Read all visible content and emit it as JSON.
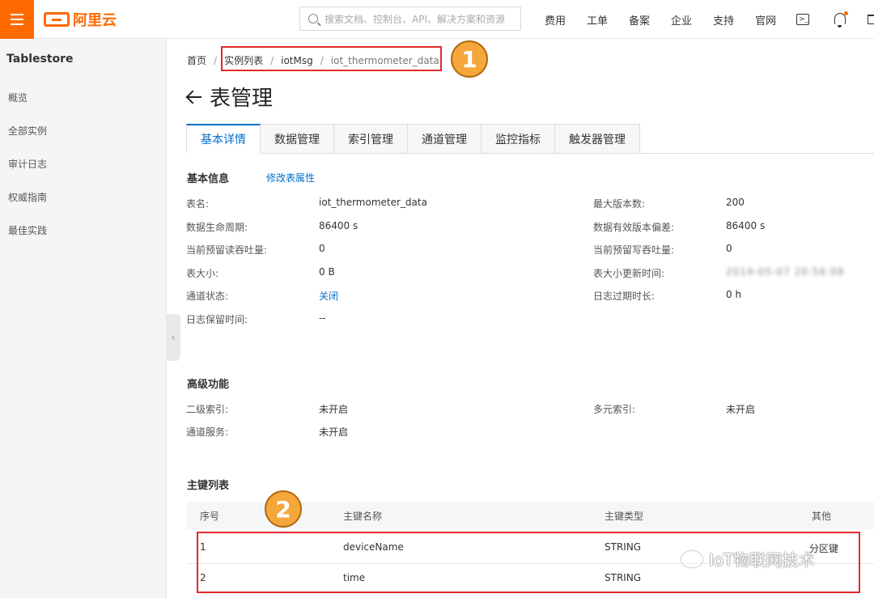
{
  "topbar": {
    "logo_text": "阿里云",
    "search_placeholder": "搜索文档、控制台、API、解决方案和资源",
    "nav": [
      "费用",
      "工单",
      "备案",
      "企业",
      "支持",
      "官网"
    ],
    "brand_color": "#ff6a00"
  },
  "sidebar": {
    "title": "Tablestore",
    "items": [
      "概览",
      "全部实例",
      "审计日志",
      "权威指南",
      "最佳实践"
    ]
  },
  "breadcrumb": [
    "首页",
    "实例列表",
    "iotMsg",
    "iot_thermometer_data"
  ],
  "markers": [
    "1",
    "2"
  ],
  "page_title": "表管理",
  "tabs": [
    "基本详情",
    "数据管理",
    "索引管理",
    "通道管理",
    "监控指标",
    "触发器管理"
  ],
  "basic": {
    "title": "基本信息",
    "edit_link": "修改表属性",
    "left": [
      {
        "label": "表名:",
        "value": "iot_thermometer_data"
      },
      {
        "label": "数据生命周期:",
        "value": "86400 s"
      },
      {
        "label": "当前预留读吞吐量:",
        "value": "0"
      },
      {
        "label": "表大小:",
        "value": "0 B"
      },
      {
        "label": "通道状态:",
        "value": "关闭"
      },
      {
        "label": "日志保留时间:",
        "value": "--"
      }
    ],
    "right": [
      {
        "label": "最大版本数:",
        "value": "200"
      },
      {
        "label": "数据有效版本偏差:",
        "value": "86400 s"
      },
      {
        "label": "当前预留写吞吐量:",
        "value": "0"
      },
      {
        "label": "表大小更新时间:",
        "value": "2019-05-07 20:56:08"
      },
      {
        "label": "日志过期时长:",
        "value": "0 h"
      }
    ]
  },
  "advanced": {
    "title": "高级功能",
    "items": [
      {
        "label": "二级索引:",
        "value": "未开启"
      },
      {
        "label": "多元索引:",
        "value": "未开启"
      },
      {
        "label": "通道服务:",
        "value": "未开启"
      }
    ]
  },
  "pk": {
    "title": "主键列表",
    "headers": [
      "序号",
      "主键名称",
      "主键类型",
      "其他"
    ],
    "rows": [
      [
        "1",
        "deviceName",
        "STRING",
        "分区键"
      ],
      [
        "2",
        "time",
        "STRING",
        ""
      ]
    ]
  },
  "watermark": "IoT物联网技术"
}
